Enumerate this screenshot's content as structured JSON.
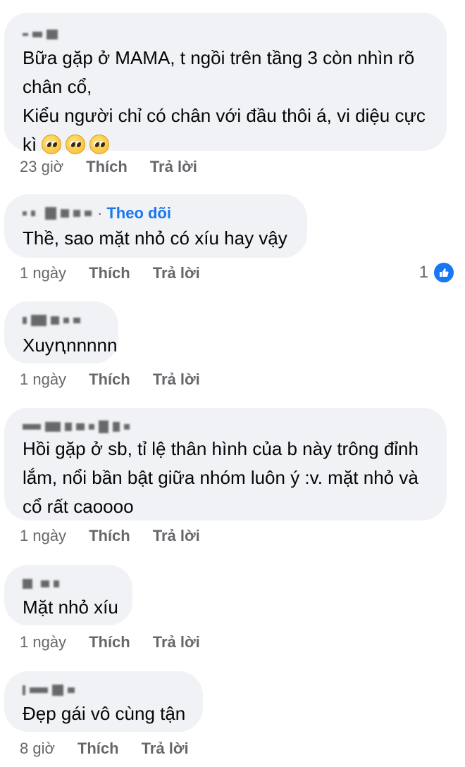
{
  "comments": [
    {
      "text_lines": [
        "Bữa gặp ở MAMA, t ngồi trên tầng 3 còn nhìn rõ",
        "chân cổ,",
        "Kiểu người chỉ có chân với đầu thôi á, vi diệu cực",
        "kì"
      ],
      "emoji_icons": [
        "pleading-face-icon",
        "pleading-face-icon",
        "pleading-face-icon"
      ],
      "time": "23 giờ",
      "like_label": "Thích",
      "reply_label": "Trả lời"
    },
    {
      "follow_label": "Theo dõi",
      "text_lines": [
        "Thề, sao mặt nhỏ có xíu hay vậy"
      ],
      "time": "1 ngày",
      "like_label": "Thích",
      "reply_label": "Trả lời",
      "reaction_count": "1",
      "reaction_icon": "like-thumb-icon"
    },
    {
      "text_lines": [
        "Xuyꞑnnnnn"
      ],
      "time": "1 ngày",
      "like_label": "Thích",
      "reply_label": "Trả lời"
    },
    {
      "text_lines": [
        "Hồi gặp ở sb, tỉ lệ thân hình của b này trông đỉnh",
        "lắm, nổi bần bật giữa nhóm luôn ý :v. mặt nhỏ và",
        "cổ rất caoooo"
      ],
      "time": "1 ngày",
      "like_label": "Thích",
      "reply_label": "Trả lời"
    },
    {
      "text_lines": [
        "Mặt nhỏ xíu"
      ],
      "time": "1 ngày",
      "like_label": "Thích",
      "reply_label": "Trả lời"
    },
    {
      "text_lines": [
        "Đẹp gái vô cùng tận"
      ],
      "time": "8 giờ",
      "like_label": "Thích",
      "reply_label": "Trả lời"
    }
  ],
  "colors": {
    "bubble": "#f0f2f5",
    "meta_text": "#65676b",
    "follow": "#1877f2",
    "like_badge": "#1877f2"
  }
}
